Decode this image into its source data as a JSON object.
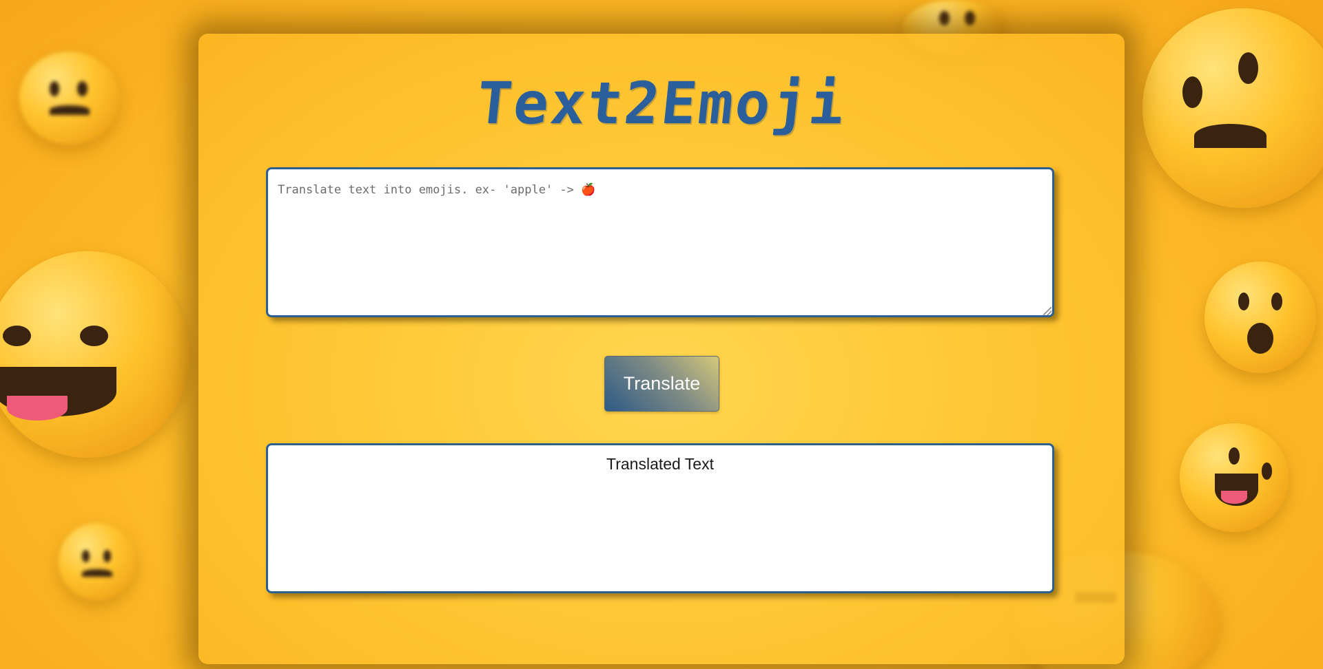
{
  "app": {
    "title": "Text2Emoji"
  },
  "input": {
    "placeholder": "Translate text into emojis. ex- 'apple' -> 🍎",
    "value": ""
  },
  "actions": {
    "translate_label": "Translate"
  },
  "output": {
    "text": "Translated Text"
  },
  "colors": {
    "accent": "#2a5f9b",
    "background": "#ffbf2a",
    "border": "#2b5f8f"
  },
  "icons": {
    "background_decoration": "emoji-faces"
  }
}
